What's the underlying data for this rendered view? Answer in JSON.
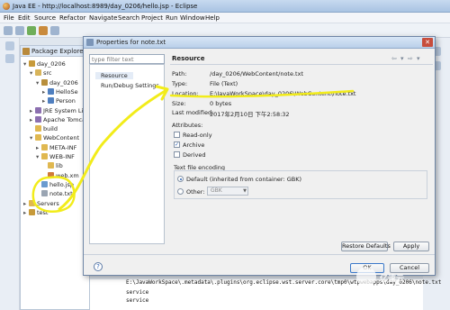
{
  "window": {
    "title": "Java EE - http://localhost:8989/day_0206/hello.jsp - Eclipse",
    "menu": [
      "File",
      "Edit",
      "Source",
      "Refactor",
      "Navigate",
      "Search",
      "Project",
      "Run",
      "Window",
      "Help"
    ]
  },
  "explorer": {
    "tab_label": "Package Explorer",
    "items": [
      {
        "label": "day_0206",
        "depth": 0,
        "icon": "project-icon",
        "toggle": "▾"
      },
      {
        "label": "src",
        "depth": 1,
        "icon": "source-folder-icon",
        "toggle": "▾"
      },
      {
        "label": "day_0206",
        "depth": 2,
        "icon": "package-icon",
        "toggle": "▾"
      },
      {
        "label": "HelloSe",
        "depth": 3,
        "icon": "java-file-icon",
        "toggle": "▸"
      },
      {
        "label": "Person",
        "depth": 3,
        "icon": "java-file-icon",
        "toggle": "▸"
      },
      {
        "label": "JRE System Lib",
        "depth": 1,
        "icon": "library-icon",
        "toggle": "▸"
      },
      {
        "label": "Apache Tomcat",
        "depth": 1,
        "icon": "library-icon",
        "toggle": "▸"
      },
      {
        "label": "build",
        "depth": 1,
        "icon": "folder-icon",
        "toggle": ""
      },
      {
        "label": "WebContent",
        "depth": 1,
        "icon": "folder-icon",
        "toggle": "▾"
      },
      {
        "label": "META-INF",
        "depth": 2,
        "icon": "folder-icon",
        "toggle": "▸"
      },
      {
        "label": "WEB-INF",
        "depth": 2,
        "icon": "folder-icon",
        "toggle": "▾"
      },
      {
        "label": "lib",
        "depth": 3,
        "icon": "folder-icon",
        "toggle": ""
      },
      {
        "label": "web.xm",
        "depth": 3,
        "icon": "xml-file-icon",
        "toggle": ""
      },
      {
        "label": "hello.jsp",
        "depth": 2,
        "icon": "jsp-file-icon",
        "toggle": ""
      },
      {
        "label": "note.txt",
        "depth": 2,
        "icon": "text-file-icon",
        "toggle": ""
      },
      {
        "label": "Servers",
        "depth": 0,
        "icon": "folder-icon",
        "toggle": "▸"
      },
      {
        "label": "test",
        "depth": 0,
        "icon": "project-icon",
        "toggle": "▸"
      }
    ]
  },
  "dialog": {
    "title": "Properties for note.txt",
    "filter_placeholder": "type filter text",
    "nav": [
      "Resource",
      "Run/Debug Settings"
    ],
    "selected_nav": "Resource",
    "header": "Resource",
    "path_label": "Path:",
    "path": "/day_0206/WebContent/note.txt",
    "type_label": "Type:",
    "type": "File  (Text)",
    "location_label": "Location:",
    "location": "E:\\JavaWorkSpace\\day_0206\\WebContent\\note.txt",
    "size_label": "Size:",
    "size": "0  bytes",
    "modified_label": "Last modified:",
    "modified": "2017年2月10日 下午2:58:32",
    "attributes_label": "Attributes:",
    "attributes": [
      {
        "label": "Read-only",
        "checked": false
      },
      {
        "label": "Archive",
        "checked": true
      },
      {
        "label": "Derived",
        "checked": false
      }
    ],
    "encoding_label": "Text file encoding",
    "encoding_default": "Default (inherited from container: GBK)",
    "encoding_other": "Other:",
    "encoding_other_value": "GBK",
    "restore_label": "Restore Defaults",
    "apply_label": "Apply",
    "ok_label": "OK",
    "cancel_label": "Cancel"
  },
  "console": {
    "lines": [
      "E:\\JavaWorkSpace\\.metadata\\.plugins\\org.eclipse.wst.server.core\\tmp0\\wtpwebapps\\day_0206\\note.txt",
      "service",
      "service"
    ]
  },
  "watermark": {
    "text": "亿速云"
  },
  "colors": {
    "annotation": "#f2ec1a",
    "selection": "#e4ecf7",
    "default_button": "#3a78c9"
  }
}
